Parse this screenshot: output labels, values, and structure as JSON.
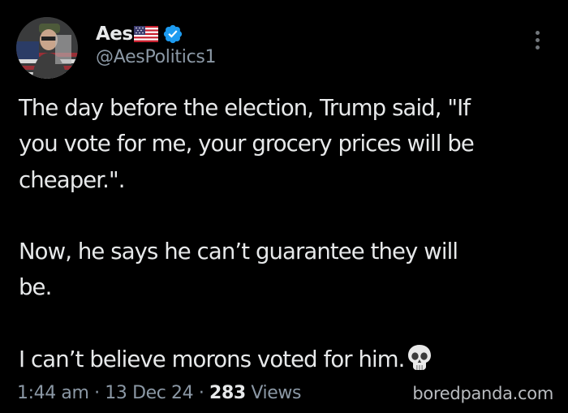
{
  "author": {
    "display_name": "Aes",
    "handle": "@AesPolitics1",
    "flag_icon": "us-flag-emoji",
    "verified_icon": "verified-badge-icon",
    "verified_color": "#1d9bf0"
  },
  "tweet": {
    "paragraphs": [
      [
        "The day before the election, Trump said, \"If",
        "you vote for me, your grocery prices will be",
        "cheaper.\"."
      ],
      [
        "Now, he says he can’t guarantee they will",
        "be."
      ],
      [
        "I can’t believe morons voted for him."
      ]
    ],
    "trailing_emoji": "skull-emoji"
  },
  "meta": {
    "time": "1:44 am",
    "sep1": " · ",
    "date": "13 Dec 24",
    "sep2": " · ",
    "views_count": "283",
    "views_label": " Views"
  },
  "watermark": "boredpanda.com",
  "colors": {
    "background": "#000000",
    "text": "#e7e9ea",
    "secondary": "#8b98a5"
  }
}
